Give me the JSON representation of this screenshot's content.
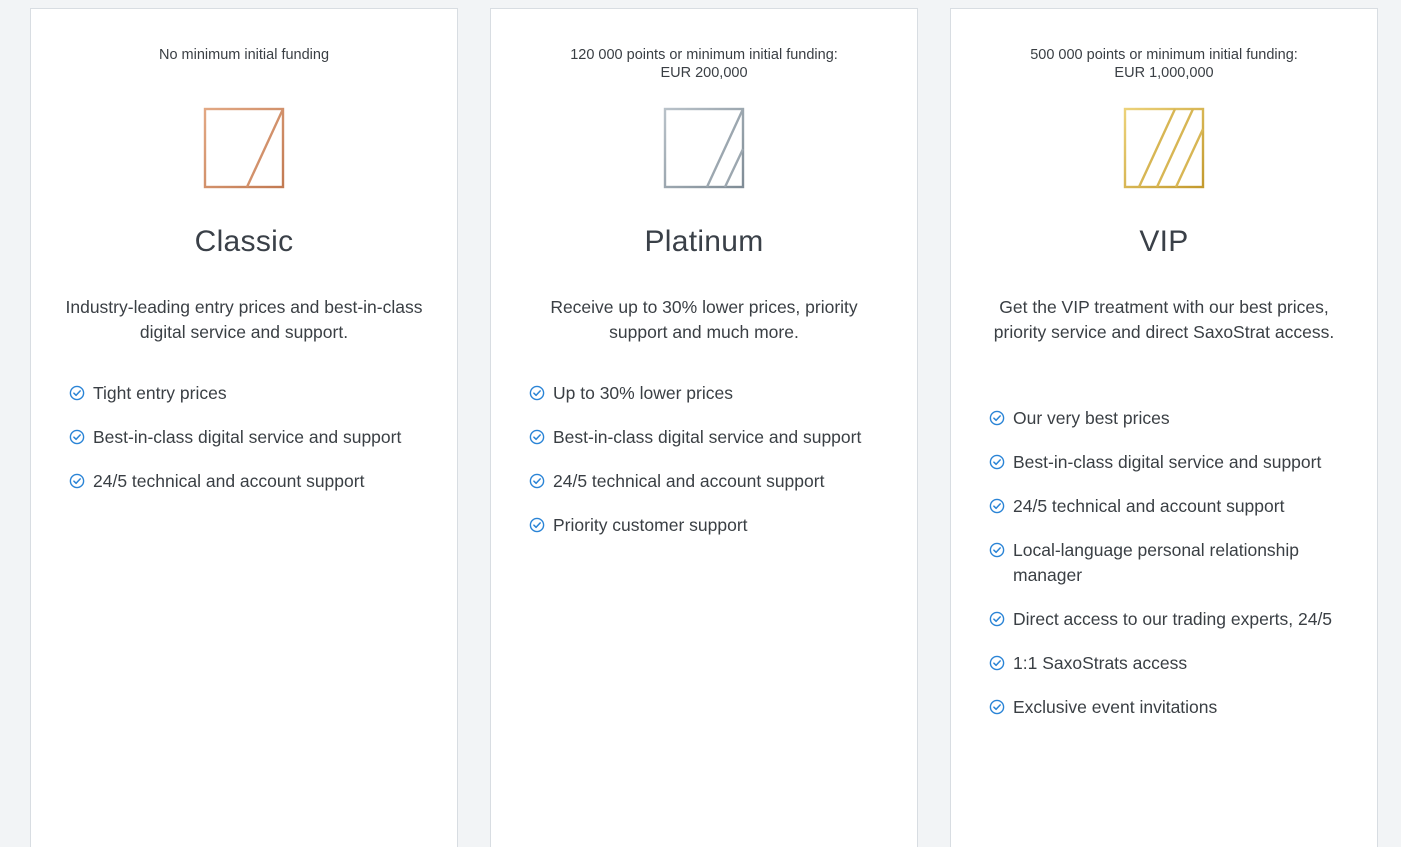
{
  "colors": {
    "page_background": "#f2f4f6",
    "card_background": "#ffffff",
    "check_icon": "#2a84d6",
    "classic_logo": "#d08a63",
    "platinum_logo": "#8e9aa4",
    "vip_logo": "#cfaa3a"
  },
  "tiers": [
    {
      "funding_line1": "No minimum initial funding",
      "funding_line2": "",
      "logo_icon": "classic-tier-logo",
      "name": "Classic",
      "description": "Industry-leading entry prices and best-in-class digital service and support.",
      "features": [
        "Tight entry prices",
        "Best-in-class digital service and support",
        "24/5 technical and account support"
      ]
    },
    {
      "funding_line1": "120 000 points or minimum initial funding:",
      "funding_line2": "EUR 200,000",
      "logo_icon": "platinum-tier-logo",
      "name": "Platinum",
      "description": "Receive up to 30% lower prices, priority support and much more.",
      "features": [
        "Up to 30% lower prices",
        "Best-in-class digital service and support",
        "24/5 technical and account support",
        "Priority customer support"
      ]
    },
    {
      "funding_line1": "500 000 points or minimum initial funding:",
      "funding_line2": "EUR 1,000,000",
      "logo_icon": "vip-tier-logo",
      "name": "VIP",
      "description": "Get the VIP treatment with our best prices, priority service and direct SaxoStrat access.",
      "features": [
        "Our very best prices",
        "Best-in-class digital service and support",
        "24/5 technical and account support",
        "Local-language personal relationship manager",
        "Direct access to our trading experts, 24/5",
        "1:1 SaxoStrats access",
        "Exclusive event invitations"
      ]
    }
  ]
}
